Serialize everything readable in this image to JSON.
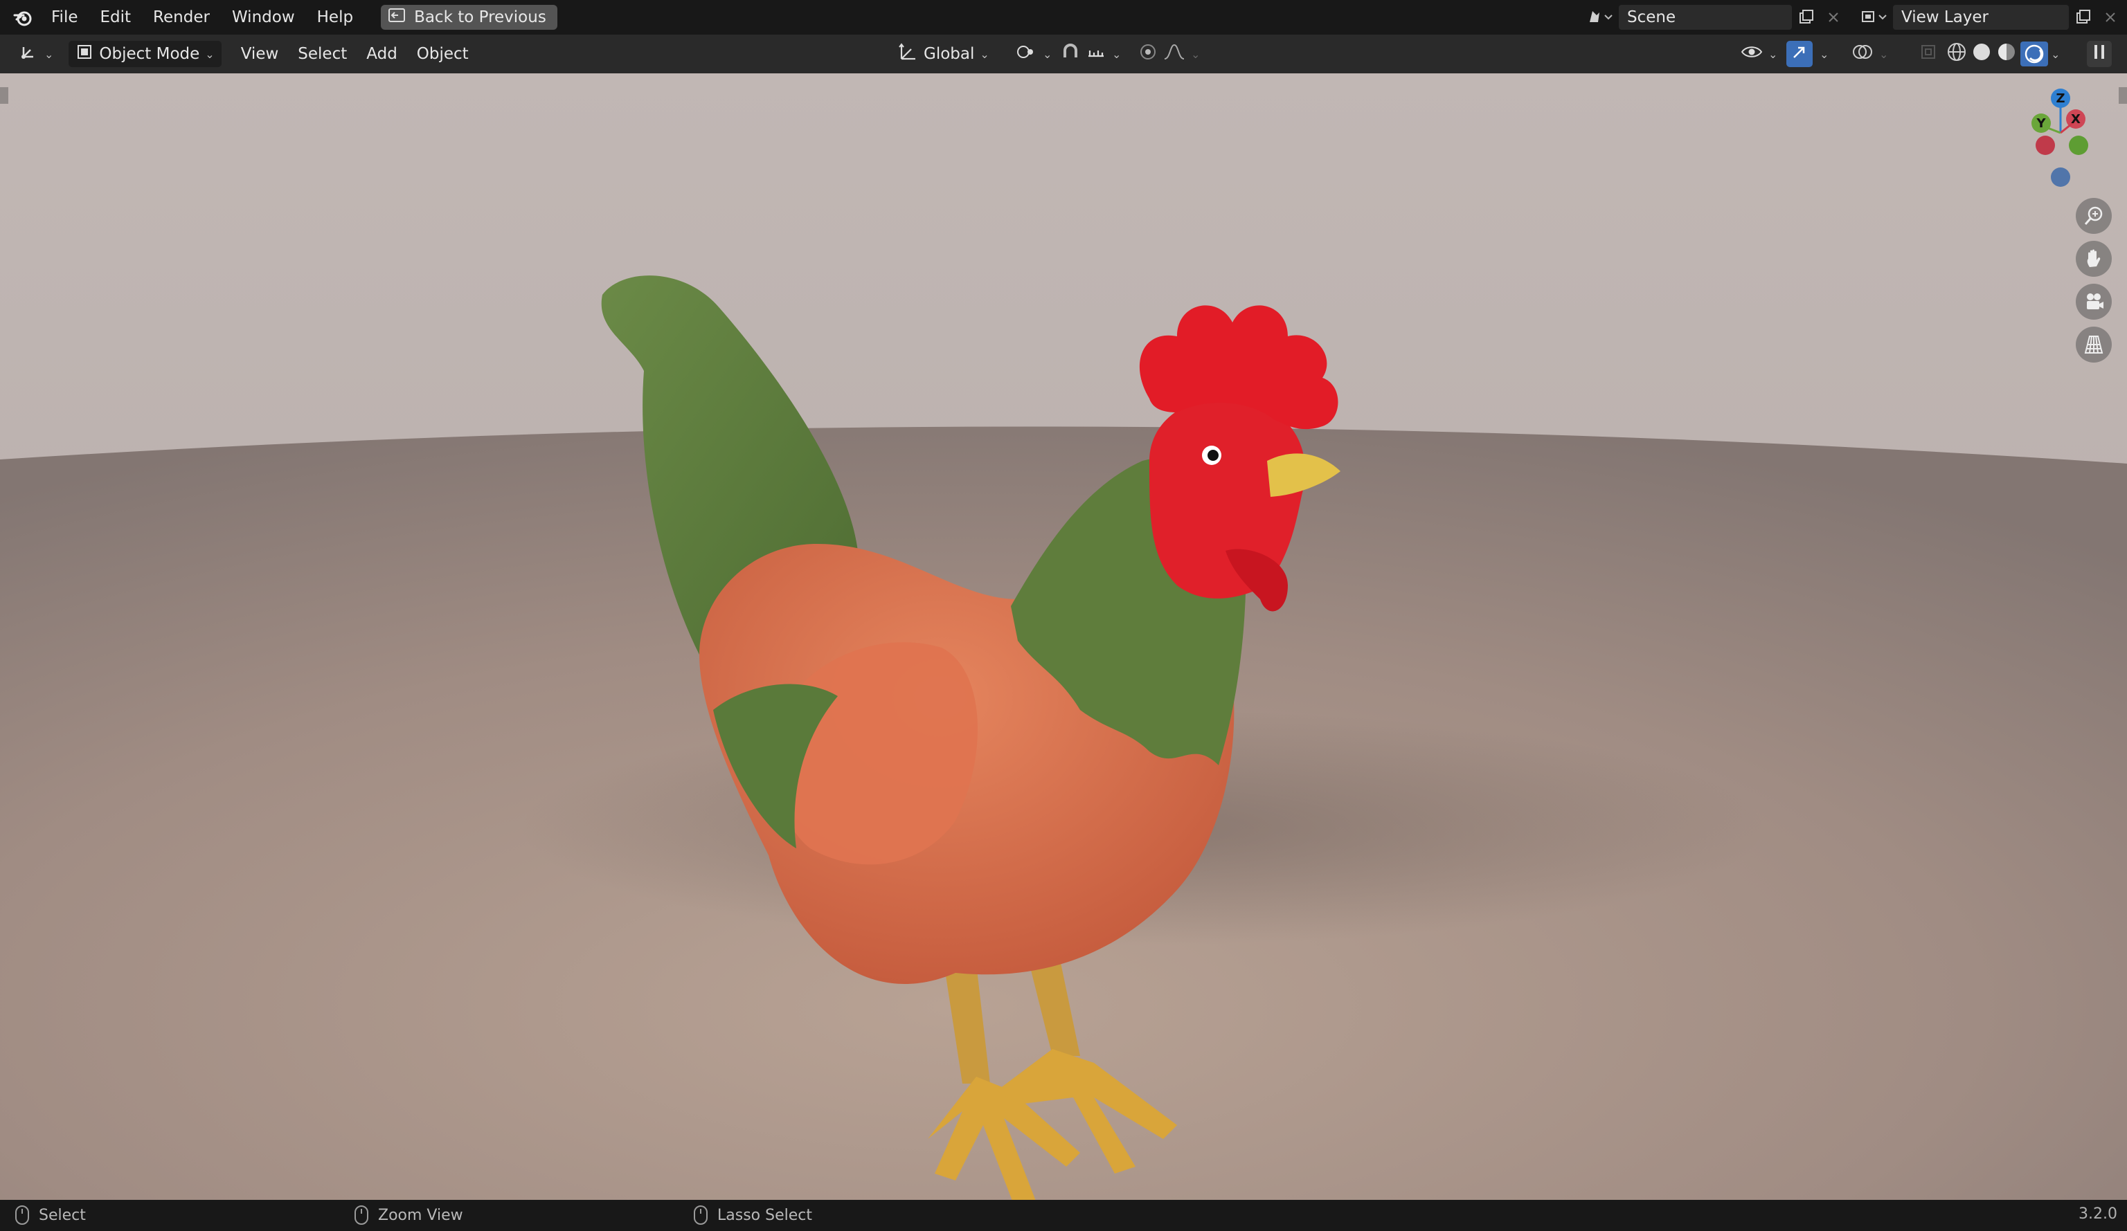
{
  "topbar": {
    "menus": [
      "File",
      "Edit",
      "Render",
      "Window",
      "Help"
    ],
    "back_button": "Back to Previous",
    "scene_name": "Scene",
    "view_layer_name": "View Layer"
  },
  "header": {
    "mode": "Object Mode",
    "menus": [
      "View",
      "Select",
      "Add",
      "Object"
    ],
    "transform_orientation": "Global"
  },
  "gizmo": {
    "z_label": "Z",
    "y_label": "Y",
    "x_label": "X",
    "colors": {
      "x": "#d03a4a",
      "y": "#6aa63a",
      "z": "#2e7fd1"
    }
  },
  "navigation_icons": [
    "zoom-icon",
    "pan-hand-icon",
    "camera-icon",
    "grid-perspective-icon"
  ],
  "statusbar": {
    "left_click": "Select",
    "middle_click": "Zoom View",
    "right_click": "Lasso Select",
    "version": "3.2.0"
  }
}
